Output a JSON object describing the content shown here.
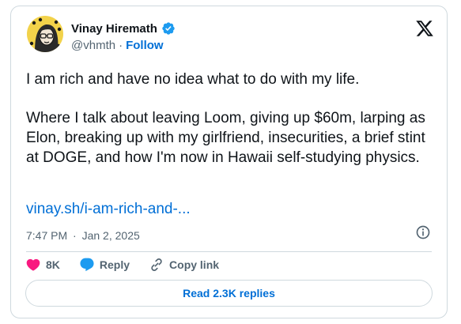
{
  "author": {
    "name": "Vinay Hiremath",
    "handle": "@vhmth",
    "separator": "·",
    "follow_label": "Follow",
    "verified_icon": "verified-badge-icon",
    "verified_color": "#1d9bf0"
  },
  "tweet": {
    "paragraph_1": "I am rich and have no idea what to do with my life.",
    "paragraph_2": "Where I talk about leaving Loom, giving up $60m, larping as Elon, breaking up with my girlfriend, insecurities, a brief stint at DOGE, and how I'm now in Hawaii self-studying physics.",
    "link": "vinay.sh/i-am-rich-and-...",
    "time": "7:47 PM",
    "separator": "·",
    "date": "Jan 2, 2025"
  },
  "actions": {
    "likes_count": "8K",
    "reply_label": "Reply",
    "copy_link_label": "Copy link",
    "like_color": "#f91880",
    "reply_color": "#1d9bf0"
  },
  "replies_button": {
    "label": "Read 2.3K replies"
  },
  "colors": {
    "accent": "#006fd6",
    "text": "#0f1419",
    "muted": "#536471",
    "border": "#cfd9de"
  }
}
